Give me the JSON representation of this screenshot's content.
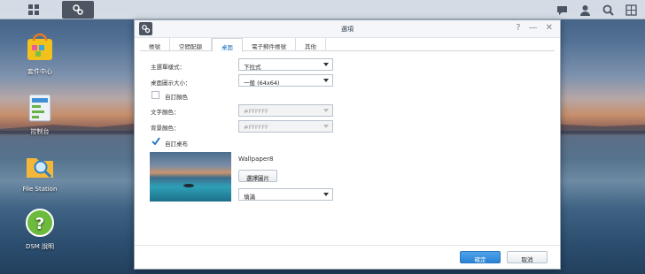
{
  "desktop": {
    "icons": [
      {
        "label": "套件中心",
        "icon": "package-center-icon"
      },
      {
        "label": "控制台",
        "icon": "control-panel-icon"
      },
      {
        "label": "File Station",
        "icon": "file-station-icon"
      },
      {
        "label": "DSM 說明",
        "icon": "help-icon"
      }
    ]
  },
  "taskbar": {
    "main_menu_icon": "grid-icon",
    "app_icon": "settings-app-icon",
    "right_icons": [
      "chat-icon",
      "user-icon",
      "search-icon",
      "widgets-icon"
    ]
  },
  "window": {
    "title": "選項",
    "controls": {
      "help": "?",
      "minimize": "—",
      "close": "✕"
    },
    "tabs": [
      "帳號",
      "空間配額",
      "桌面",
      "電子郵件帳號",
      "其他"
    ],
    "active_tab": "桌面",
    "form": {
      "main_menu_style_label": "主選單樣式：",
      "main_menu_style_value": "下拉式",
      "desktop_icon_size_label": "桌面圖示大小：",
      "desktop_icon_size_value": "一般 (64x64)",
      "custom_color_label": "自訂顏色",
      "custom_color_checked": false,
      "text_color_label": "文字顏色：",
      "text_color_value": "#FFFFFF",
      "bg_color_label": "背景顏色：",
      "bg_color_value": "#FFFFFF",
      "custom_wallpaper_label": "自訂桌布",
      "custom_wallpaper_checked": true,
      "wallpaper_name": "Wallpaper8",
      "select_image_label": "選擇圖片",
      "fill_mode_value": "填滿"
    },
    "footer": {
      "ok_label": "確定",
      "cancel_label": "取消"
    }
  },
  "colors": {
    "accent": "#2a82d4",
    "active_tab": "#1a6fbf",
    "check": "#1a6fbf"
  }
}
